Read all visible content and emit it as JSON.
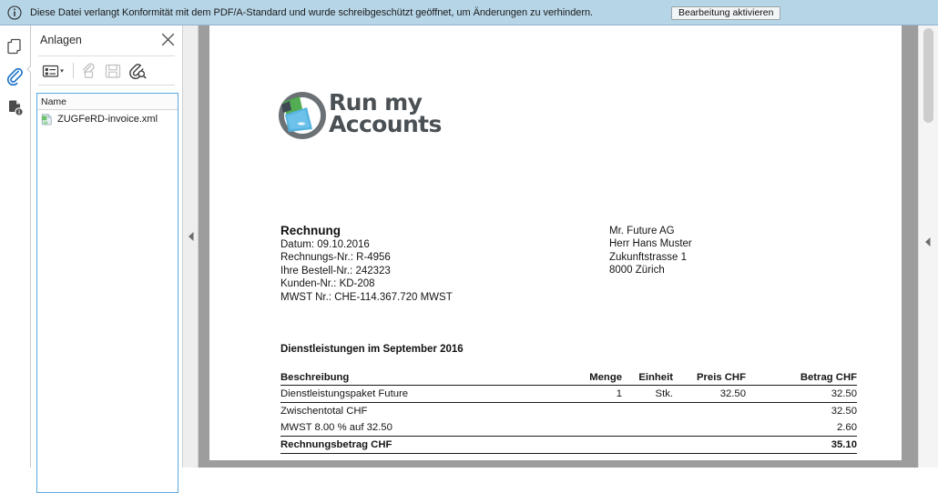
{
  "notification": {
    "icon": "info-icon",
    "message": "Diese Datei verlangt Konformität mit dem PDF/A-Standard und wurde schreibgeschützt geöffnet, um Änderungen zu verhindern.",
    "button_label": "Bearbeitung aktivieren",
    "background_color": "#b6d5e7"
  },
  "icon_rail": {
    "items": [
      {
        "name": "page-thumbnails-icon",
        "label": "Seitenminiaturen",
        "active": false
      },
      {
        "name": "attachments-icon",
        "label": "Anlagen",
        "active": true,
        "active_color": "#1a73c8"
      },
      {
        "name": "document-info-icon",
        "label": "Dokumentinformationen",
        "active": false
      }
    ]
  },
  "panel": {
    "title": "Anlagen",
    "close_label": "×",
    "toolbar": [
      {
        "name": "options-menu-button",
        "label": "Optionen",
        "enabled": true
      },
      {
        "name": "attach-file-button",
        "label": "Datei anhängen",
        "enabled": false
      },
      {
        "name": "save-attachment-button",
        "label": "Anlage speichern",
        "enabled": false
      },
      {
        "name": "search-attachments-button",
        "label": "Anlagen durchsuchen",
        "enabled": true
      }
    ],
    "list": {
      "columns": [
        "Name"
      ],
      "rows": [
        {
          "icon": "xml-file-icon",
          "name": "ZUGFeRD-invoice.xml"
        }
      ],
      "focus_border_color": "#5aa9e0"
    }
  },
  "splitter": {
    "collapse_icon": "triangle-left-icon"
  },
  "viewer": {
    "background_color": "#9d9d9d",
    "scrollbar": {
      "thumb_color": "#cdcdcd",
      "collapse_icon": "triangle-left-icon"
    }
  },
  "document": {
    "logo": {
      "mark": "run-my-accounts-swoosh",
      "line1": "Run my",
      "line2": "Accounts",
      "color": "#4a5054",
      "accent_green": "#5cc24a",
      "accent_blue": "#3f9fd4"
    },
    "invoice": {
      "heading": "Rechnung",
      "meta": [
        "Datum: 09.10.2016",
        "Rechnungs-Nr.: R-4956",
        "Ihre Bestell-Nr.: 242323",
        "Kunden-Nr.: KD-208",
        "MWST Nr.: CHE-114.367.720 MWST"
      ]
    },
    "recipient": [
      "Mr. Future AG",
      "Herr Hans Muster",
      "Zukunftstrasse 1",
      "8000 Zürich"
    ],
    "section_title": "Dienstleistungen im September 2016",
    "table": {
      "headers": {
        "description": "Beschreibung",
        "quantity": "Menge",
        "unit": "Einheit",
        "price": "Preis CHF",
        "amount": "Betrag CHF"
      },
      "items": [
        {
          "description": "Dienstleistungspaket Future",
          "quantity": "1",
          "unit": "Stk.",
          "price": "32.50",
          "amount": "32.50"
        }
      ],
      "summary": [
        {
          "label": "Zwischentotal CHF",
          "amount": "32.50"
        },
        {
          "label": "MWST 8.00 % auf 32.50",
          "amount": "2.60"
        }
      ],
      "total": {
        "label": "Rechnungsbetrag  CHF",
        "amount": "35.10"
      }
    }
  }
}
